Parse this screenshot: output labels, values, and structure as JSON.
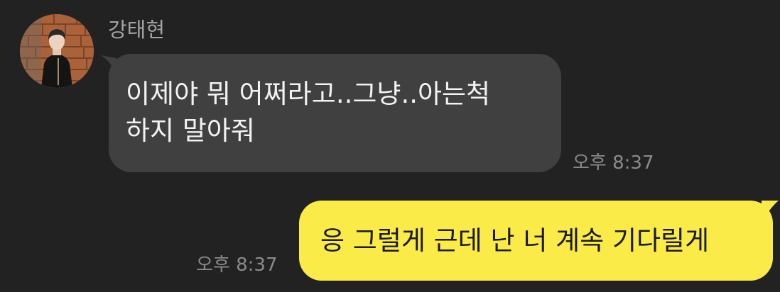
{
  "chat": {
    "sender_name": "강태현",
    "avatar_icon": "profile-photo-avatar",
    "incoming": {
      "line1": "이제야 뭐 어쩌라고..그냥..아는척",
      "line2": "하지 말아줘",
      "time": "오후 8:37"
    },
    "outgoing": {
      "text": "응 그럴게 근데 난 너 계속 기다릴게",
      "time": "오후 8:37"
    }
  },
  "colors": {
    "background": "#222222",
    "incoming_bubble": "#404040",
    "outgoing_bubble": "#fbeb48",
    "timestamp": "#8a8a8a",
    "sender_name": "#a4a4a4"
  }
}
